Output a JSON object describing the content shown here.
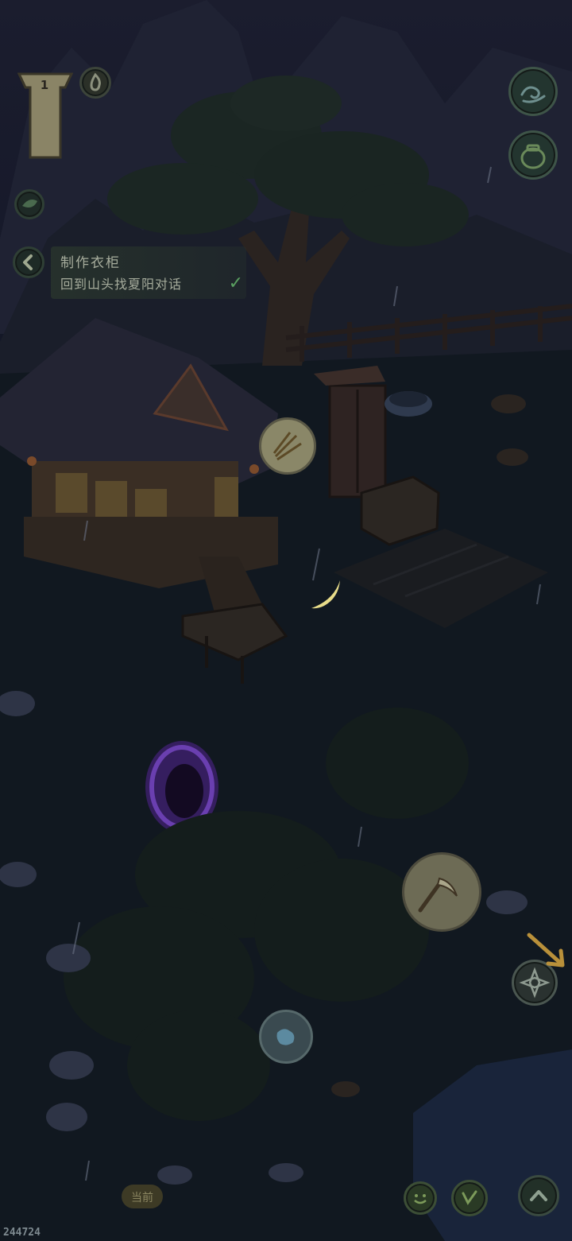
{
  "hud": {
    "level": "1",
    "quest": {
      "title": "制作衣柜",
      "step": "回到山头找夏阳对话",
      "completed": true
    },
    "location_label": "当前",
    "coordinates": "244724"
  },
  "icons": {
    "level_banner": "wooden-post-icon",
    "fire": "flame-icon",
    "collapse": "chevron-left-icon",
    "leaf": "leaf-icon",
    "wind": "wave-swirl-icon",
    "jar": "jar-icon",
    "wheat": "wheat-bundle-icon",
    "scythe": "scythe-icon",
    "map": "map-globe-icon",
    "compass": "compass-icon",
    "emote": "smile-icon",
    "tool": "tool-icon",
    "up": "chevron-up-icon"
  },
  "colors": {
    "accent_green": "#5aa060",
    "quest_text": "#a7ad9d",
    "portal": "#6a3fb0",
    "hint_arrow": "#b9903a"
  }
}
